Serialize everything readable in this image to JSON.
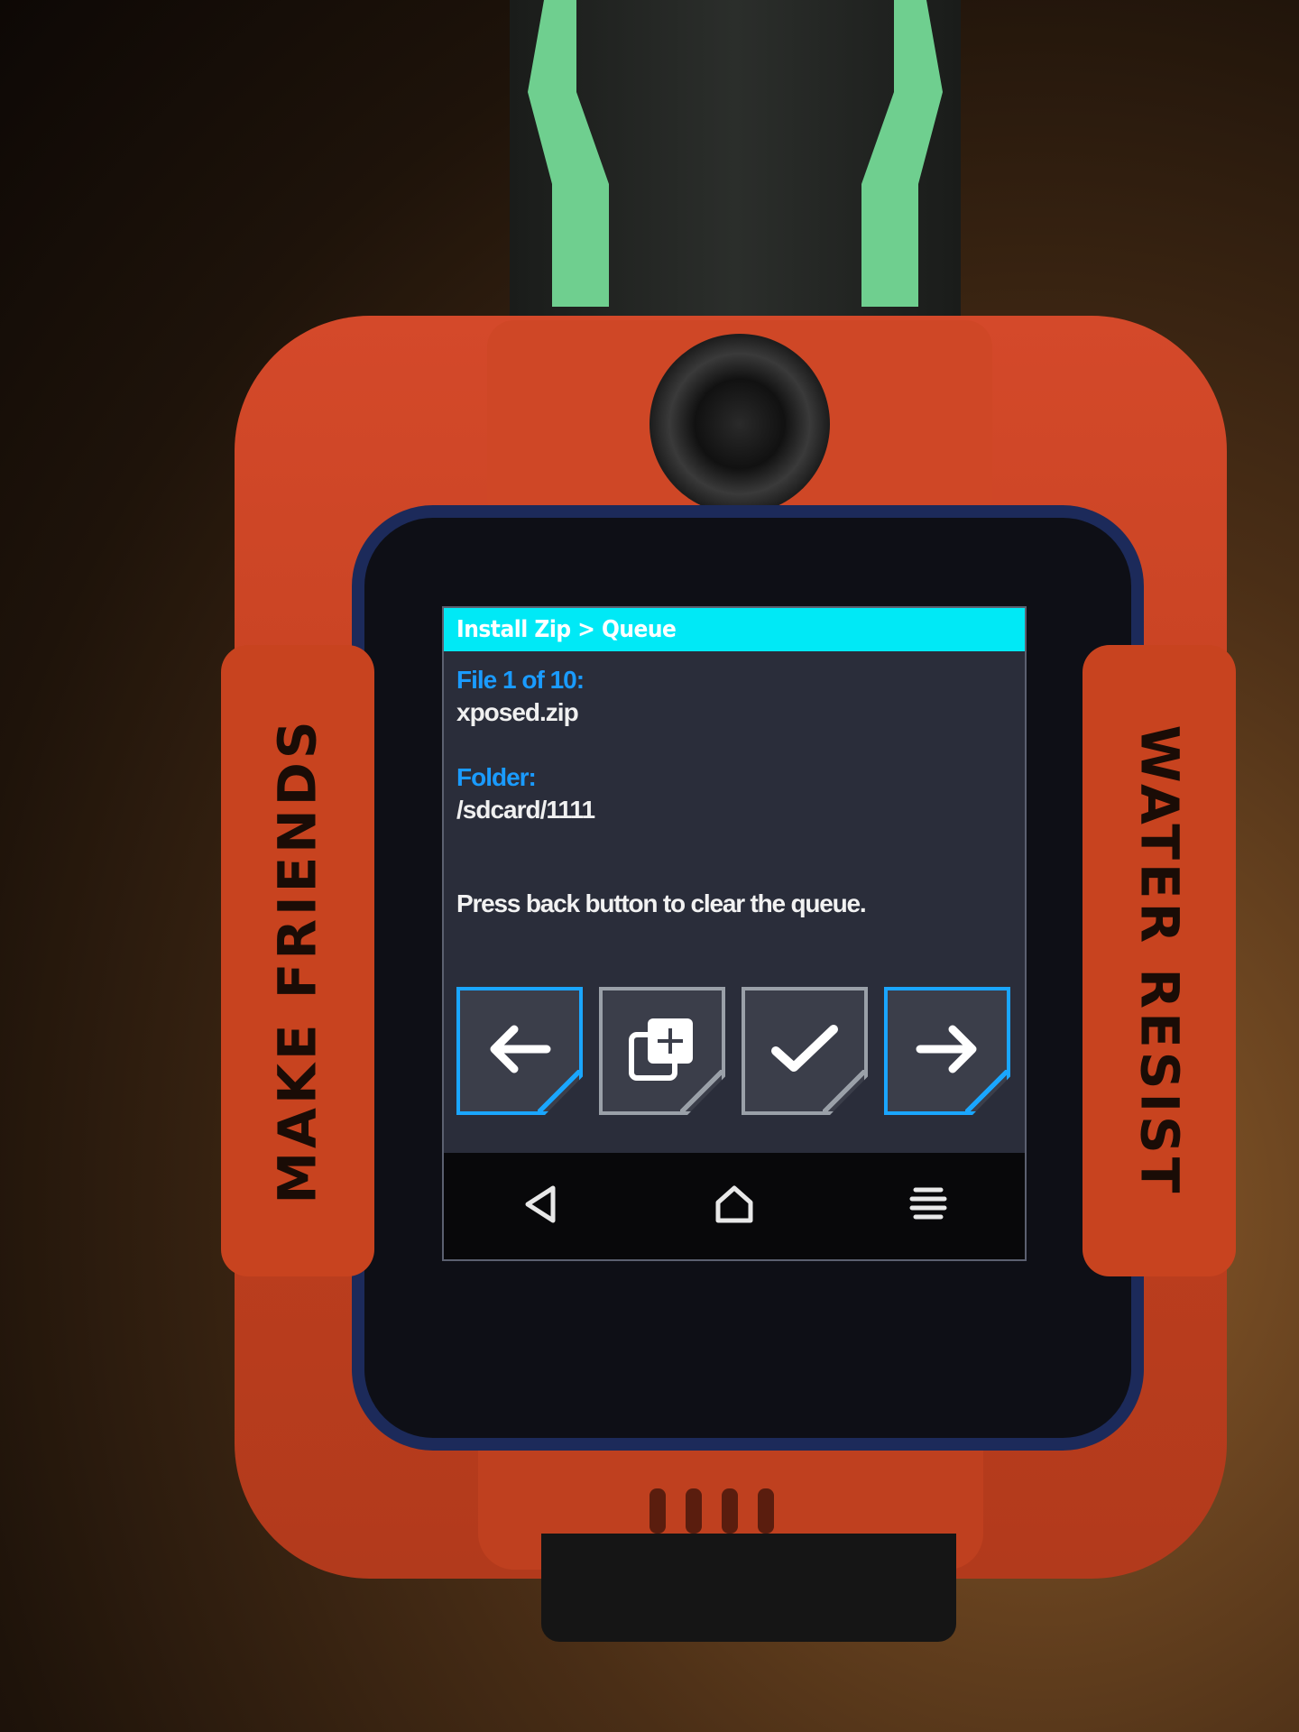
{
  "device": {
    "left_band_text": "MAKE FRIENDS",
    "right_band_text": "WATER RESIST"
  },
  "screen": {
    "title": "Install Zip > Queue",
    "file_label": "File 1 of 10:",
    "file_name": "xposed.zip",
    "folder_label": "Folder:",
    "folder_path": "/sdcard/1111",
    "message": "Press back button to clear the queue."
  },
  "buttons": [
    {
      "icon": "arrow-left-icon"
    },
    {
      "icon": "add-queue-icon"
    },
    {
      "icon": "checkmark-icon"
    },
    {
      "icon": "arrow-right-icon"
    }
  ],
  "navigation": [
    {
      "icon": "back-icon"
    },
    {
      "icon": "home-icon"
    },
    {
      "icon": "menu-icon"
    }
  ],
  "colors": {
    "title_bar": "#00e9f6",
    "label_text": "#1a9bff",
    "nav_button_border": "#1aa6ff",
    "action_button_border": "#9aa0a8",
    "screen_background": "#2a2d3a"
  }
}
